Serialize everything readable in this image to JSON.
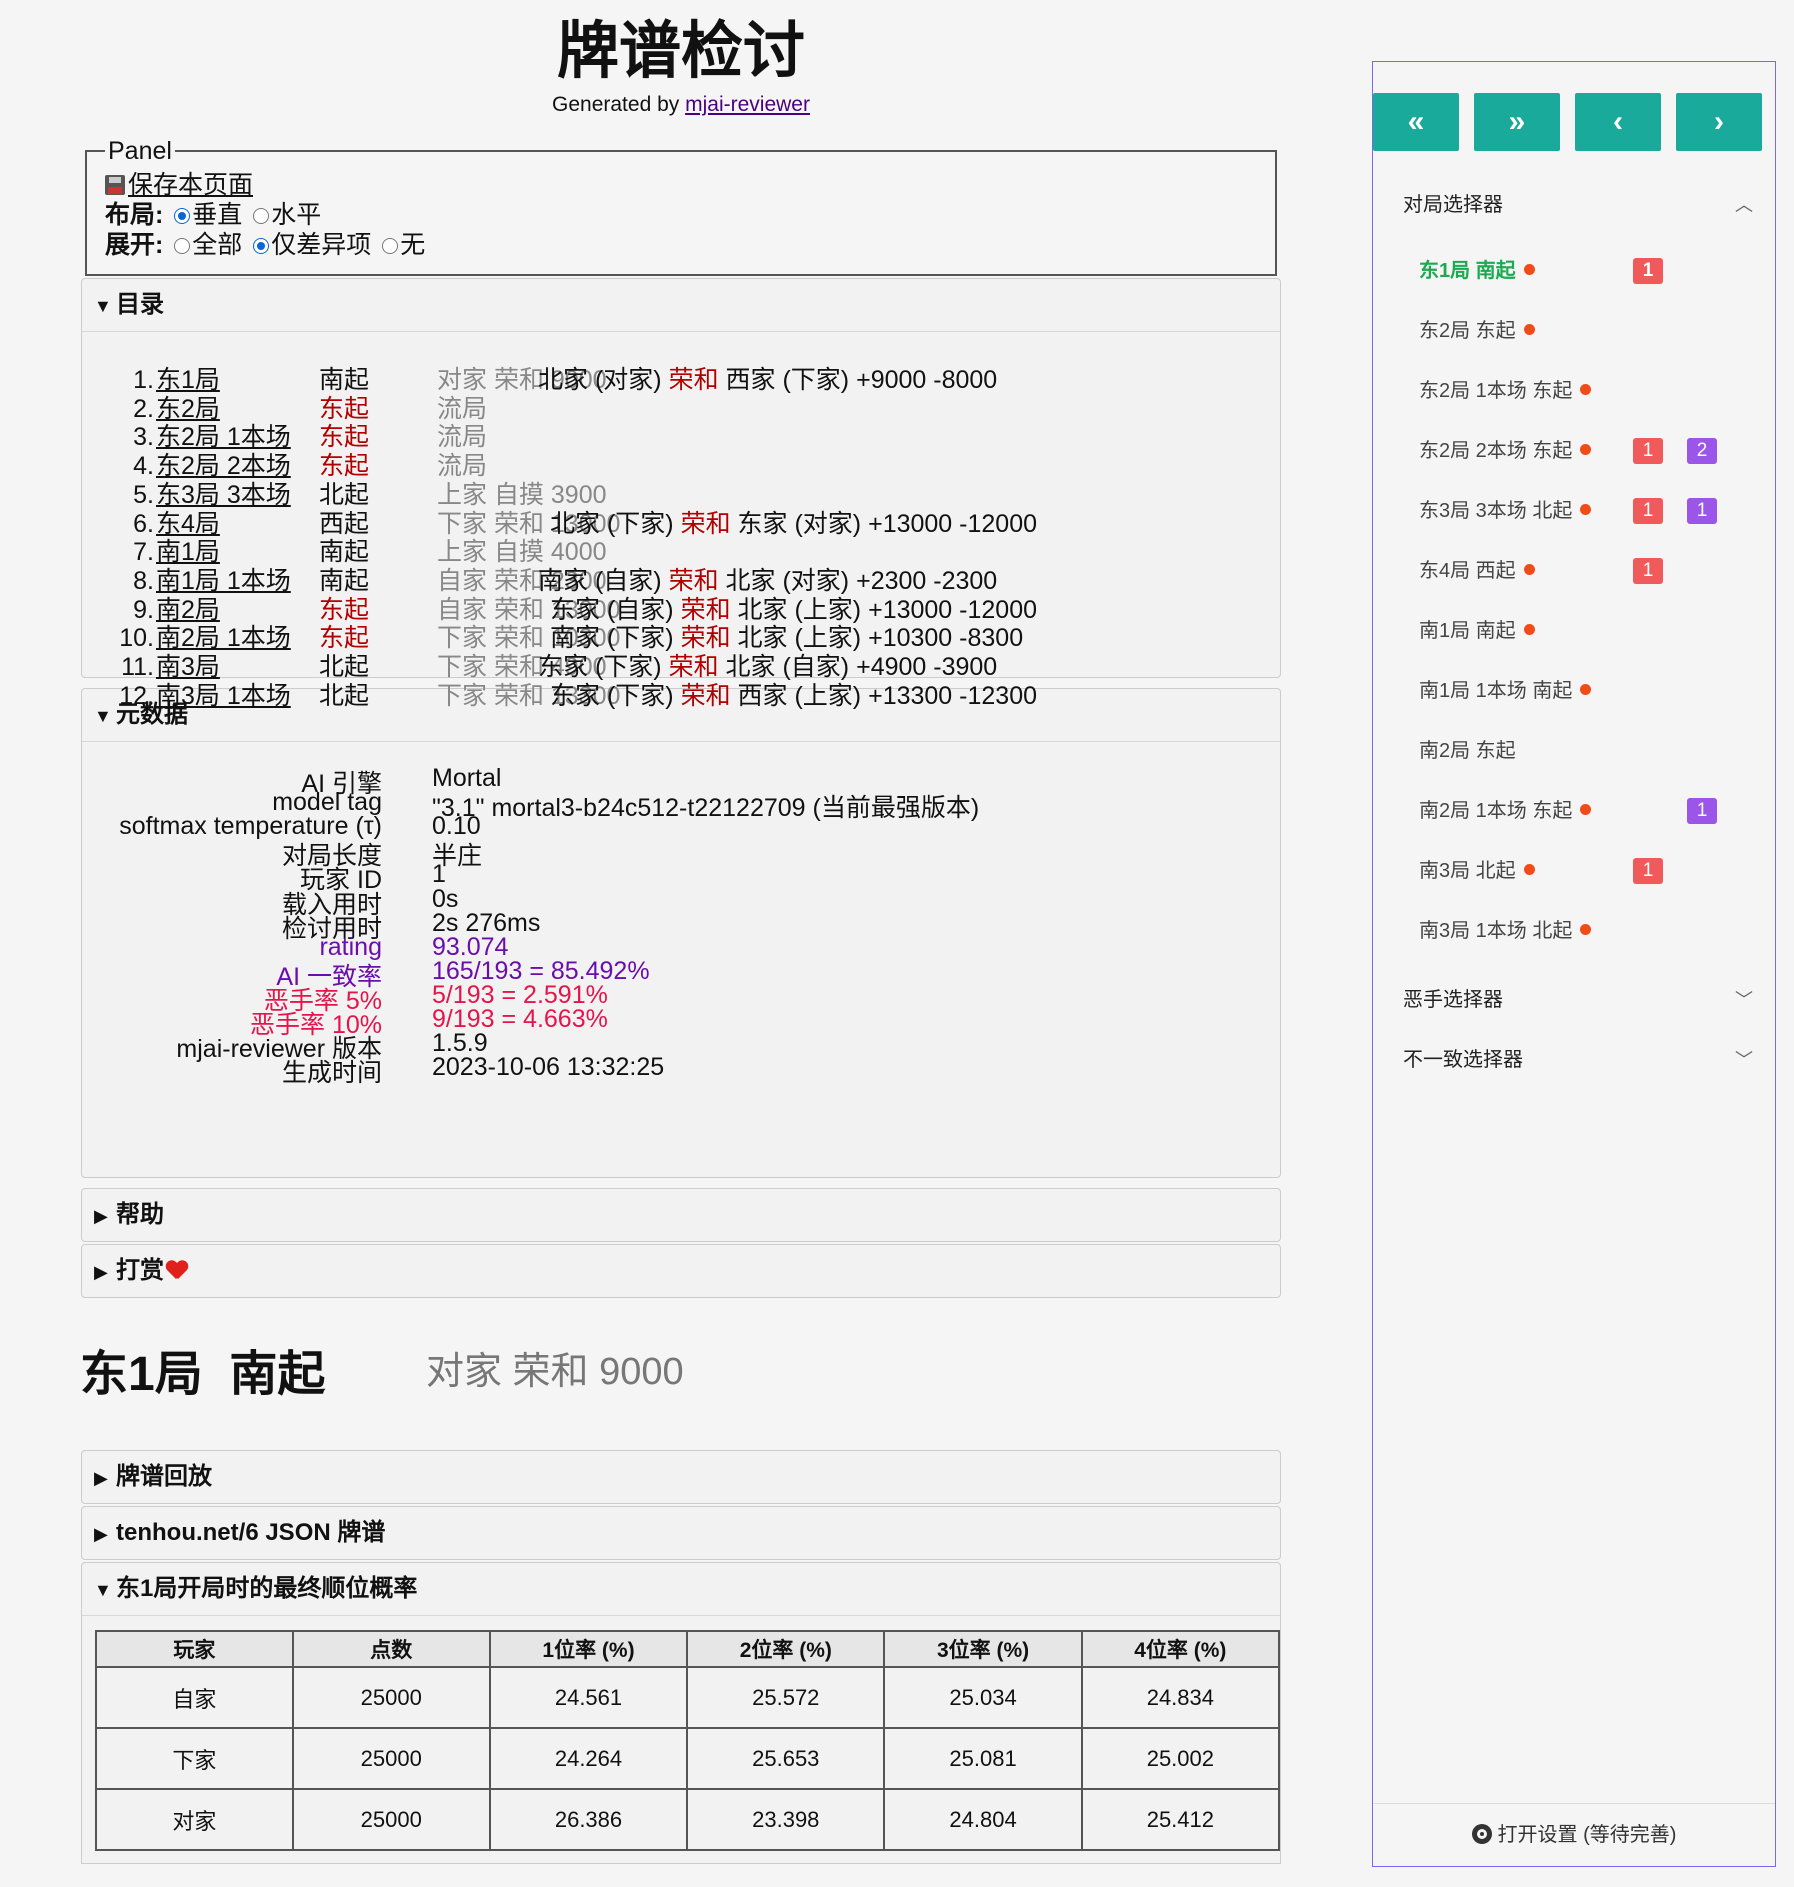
{
  "header": {
    "title": "牌谱检讨",
    "generated_prefix": "Generated by ",
    "generated_link": "mjai-reviewer"
  },
  "panel": {
    "legend": "Panel",
    "save_label": "保存本页面",
    "layout_label": "布局:",
    "layout_options": [
      "垂直",
      "水平"
    ],
    "layout_selected": "垂直",
    "expand_label": "展开:",
    "expand_options": [
      "全部",
      "仅差异项",
      "无"
    ],
    "expand_selected": "仅差异项"
  },
  "toc": {
    "heading": "目录",
    "rows": [
      {
        "num": "1.",
        "round": "东1局",
        "dealer": "南起",
        "dealer_red": false,
        "result": "对家 荣和 9000",
        "winner": "北家 (对家)",
        "win": "荣和",
        "loser": "西家 (下家)",
        "delta": "+9000 -8000"
      },
      {
        "num": "2.",
        "round": "东2局",
        "dealer": "东起",
        "dealer_red": true,
        "result": "流局",
        "winner": "",
        "win": "",
        "loser": "",
        "delta": ""
      },
      {
        "num": "3.",
        "round": "东2局 1本场",
        "dealer": "东起",
        "dealer_red": true,
        "result": "流局",
        "winner": "",
        "win": "",
        "loser": "",
        "delta": ""
      },
      {
        "num": "4.",
        "round": "东2局 2本场",
        "dealer": "东起",
        "dealer_red": true,
        "result": "流局",
        "winner": "",
        "win": "",
        "loser": "",
        "delta": ""
      },
      {
        "num": "5.",
        "round": "东3局 3本场",
        "dealer": "北起",
        "dealer_red": false,
        "result": "上家 自摸 3900",
        "winner": "",
        "win": "",
        "loser": "",
        "delta": ""
      },
      {
        "num": "6.",
        "round": "东4局",
        "dealer": "西起",
        "dealer_red": false,
        "result": "下家 荣和 13000",
        "winner": "北家 (下家)",
        "win": "荣和",
        "loser": "东家 (对家)",
        "delta": "+13000 -12000"
      },
      {
        "num": "7.",
        "round": "南1局",
        "dealer": "南起",
        "dealer_red": false,
        "result": "上家 自摸 4000",
        "winner": "",
        "win": "",
        "loser": "",
        "delta": ""
      },
      {
        "num": "8.",
        "round": "南1局 1本场",
        "dealer": "南起",
        "dealer_red": false,
        "result": "自家 荣和 2300",
        "winner": "南家 (自家)",
        "win": "荣和",
        "loser": "北家 (对家)",
        "delta": "+2300 -2300"
      },
      {
        "num": "9.",
        "round": "南2局",
        "dealer": "东起",
        "dealer_red": true,
        "result": "自家 荣和 13000",
        "winner": "东家 (自家)",
        "win": "荣和",
        "loser": "北家 (上家)",
        "delta": "+13000 -12000"
      },
      {
        "num": "10.",
        "round": "南2局 1本场",
        "dealer": "东起",
        "dealer_red": true,
        "result": "下家 荣和 10300",
        "winner": "南家 (下家)",
        "win": "荣和",
        "loser": "北家 (上家)",
        "delta": "+10300 -8300"
      },
      {
        "num": "11.",
        "round": "南3局",
        "dealer": "北起",
        "dealer_red": false,
        "result": "下家 荣和 4900",
        "winner": "东家 (下家)",
        "win": "荣和",
        "loser": "北家 (自家)",
        "delta": "+4900 -3900"
      },
      {
        "num": "12.",
        "round": "南3局 1本场",
        "dealer": "北起",
        "dealer_red": false,
        "result": "下家 荣和 13300",
        "winner": "东家 (下家)",
        "win": "荣和",
        "loser": "西家 (上家)",
        "delta": "+13300 -12300"
      }
    ]
  },
  "metadata": {
    "heading": "元数据",
    "rows": [
      {
        "key": "AI 引擎",
        "value": "Mortal",
        "style": ""
      },
      {
        "key": "model tag",
        "value": "\"3.1\" mortal3-b24c512-t22122709 (当前最强版本)",
        "style": ""
      },
      {
        "key": "softmax temperature (τ)",
        "value": "0.10",
        "style": ""
      },
      {
        "key": "对局长度",
        "value": "半庄",
        "style": ""
      },
      {
        "key": "玩家 ID",
        "value": "1",
        "style": ""
      },
      {
        "key": "载入用时",
        "value": "0s",
        "style": ""
      },
      {
        "key": "检讨用时",
        "value": "2s 276ms",
        "style": ""
      },
      {
        "key": "rating",
        "value": "93.074",
        "style": "purple"
      },
      {
        "key": "AI 一致率",
        "value": "165/193 = 85.492%",
        "style": "purple"
      },
      {
        "key": "恶手率 5%",
        "value": "5/193 = 2.591%",
        "style": "pink"
      },
      {
        "key": "恶手率 10%",
        "value": "9/193 = 4.663%",
        "style": "pink"
      },
      {
        "key": "mjai-reviewer 版本",
        "value": "1.5.9",
        "style": ""
      },
      {
        "key": "生成时间",
        "value": "2023-10-06 13:32:25",
        "style": ""
      }
    ]
  },
  "sections": {
    "help": "帮助",
    "donate": "打赏",
    "replay": "牌谱回放",
    "json": "tenhou.net/6 JSON 牌谱",
    "prob": "东1局开局时的最终顺位概率"
  },
  "round": {
    "title": "东1局  南起",
    "result": "对家 荣和 9000"
  },
  "prob_table": {
    "headers": [
      "玩家",
      "点数",
      "1位率 (%)",
      "2位率 (%)",
      "3位率 (%)",
      "4位率 (%)"
    ],
    "rows": [
      [
        "自家",
        "25000",
        "24.561",
        "25.572",
        "25.034",
        "24.834"
      ],
      [
        "下家",
        "25000",
        "24.264",
        "25.653",
        "25.081",
        "25.002"
      ],
      [
        "对家",
        "25000",
        "26.386",
        "23.398",
        "24.804",
        "25.412"
      ]
    ]
  },
  "sidebar": {
    "nav": [
      "«",
      "»",
      "‹",
      "›"
    ],
    "game_selector": "对局选择器",
    "games": [
      {
        "label": "东1局 南起",
        "dot": true,
        "red": "1",
        "purple": "",
        "active": true
      },
      {
        "label": "东2局 东起",
        "dot": true,
        "red": "",
        "purple": "",
        "active": false
      },
      {
        "label": "东2局 1本场 东起",
        "dot": true,
        "red": "",
        "purple": "",
        "active": false
      },
      {
        "label": "东2局 2本场 东起",
        "dot": true,
        "red": "1",
        "purple": "2",
        "active": false
      },
      {
        "label": "东3局 3本场 北起",
        "dot": true,
        "red": "1",
        "purple": "1",
        "active": false
      },
      {
        "label": "东4局 西起",
        "dot": true,
        "red": "1",
        "purple": "",
        "active": false
      },
      {
        "label": "南1局 南起",
        "dot": true,
        "red": "",
        "purple": "",
        "active": false
      },
      {
        "label": "南1局 1本场 南起",
        "dot": true,
        "red": "",
        "purple": "",
        "active": false
      },
      {
        "label": "南2局 东起",
        "dot": false,
        "red": "",
        "purple": "",
        "active": false
      },
      {
        "label": "南2局 1本场 东起",
        "dot": true,
        "red": "",
        "purple": "1",
        "active": false
      },
      {
        "label": "南3局 北起",
        "dot": true,
        "red": "1",
        "purple": "",
        "active": false
      },
      {
        "label": "南3局 1本场 北起",
        "dot": true,
        "red": "",
        "purple": "",
        "active": false
      }
    ],
    "bad_selector": "恶手选择器",
    "mismatch_selector": "不一致选择器",
    "settings": "打开设置 (等待完善)"
  },
  "colors": {
    "accent": "#1aaa9b",
    "active_green": "#1aaa50",
    "badge_red": "#f05a5a",
    "badge_purple": "#9b55e8",
    "dealer_red": "#b00000",
    "rating_purple": "#6a0dad",
    "bad_pink": "#e5154c"
  }
}
